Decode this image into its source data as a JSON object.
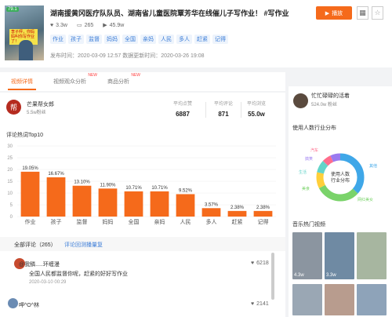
{
  "header": {
    "thumb_badge": "79.1",
    "thumb_caption": "李子枰，你妈妈叫你写作业了！",
    "title": "湖南援黄冈医疗队队员、湖南省儿童医院覃芳华在线催儿子写作业！ #写作业",
    "likes": "3.3w",
    "comments": "265",
    "plays": "45.9w",
    "tags": [
      "作业",
      "孩子",
      "监督",
      "妈妈",
      "全国",
      "亲妈",
      "人民",
      "多人",
      "赶紧",
      "记得"
    ],
    "publish": "发布时间：2020-03-09 12:57 数据更新时间：2020-03-26 19:08",
    "play_btn": "播放"
  },
  "tabs": [
    {
      "label": "视频详情",
      "new": ""
    },
    {
      "label": "视频观众分析",
      "new": "NEW"
    },
    {
      "label": "商品分析",
      "new": "NEW"
    }
  ],
  "author": {
    "name": "芒果帮女郎",
    "fans": "5.5w粉丝",
    "metrics": [
      {
        "label": "平均点赞",
        "value": "6887"
      },
      {
        "label": "平均评论",
        "value": "871"
      },
      {
        "label": "平均浏览",
        "value": "55.0w"
      }
    ]
  },
  "heat_title": "评论热词Top10",
  "chart_data": {
    "type": "bar",
    "categories": [
      "作业",
      "孩子",
      "监督",
      "妈妈",
      "全国",
      "亲妈",
      "人民",
      "多人",
      "赶紧",
      "记得"
    ],
    "values": [
      19.05,
      16.67,
      13.1,
      11.9,
      10.71,
      10.71,
      9.52,
      3.57,
      2.38,
      2.38
    ],
    "labels": [
      "19.05%",
      "16.67%",
      "13.10%",
      "11.90%",
      "10.71%",
      "10.71%",
      "9.52%",
      "3.57%",
      "2.38%",
      "2.38%"
    ],
    "yticks": [
      "0",
      "5",
      "10",
      "15",
      "20",
      "25",
      "30"
    ],
    "ylim": [
      0,
      30
    ],
    "color": "#f56a1b"
  },
  "comments": {
    "header": "全部评论（265）",
    "link": "评论回测播量复",
    "items": [
      {
        "user": "@我鳞.....环缠漫",
        "text": "全国人民都监督你呢，赶紧的好好写作业",
        "time": "2020-03-10 00:29",
        "likes": "6218"
      },
      {
        "user": "呷^O^林",
        "likes": "2141"
      }
    ]
  },
  "side": {
    "name": "忙忙碌碌的活着",
    "fans": "524.0w 粉丝",
    "dist_title": "使用人数行业分布",
    "donut_center": "使用人数行业分布",
    "donut_labels": [
      "汽车",
      "搞笑",
      "生活",
      "美食",
      "其他",
      "网红美女"
    ],
    "music_title": "音乐热门视频",
    "video_counts": [
      "4.3w",
      "3.3w"
    ]
  }
}
